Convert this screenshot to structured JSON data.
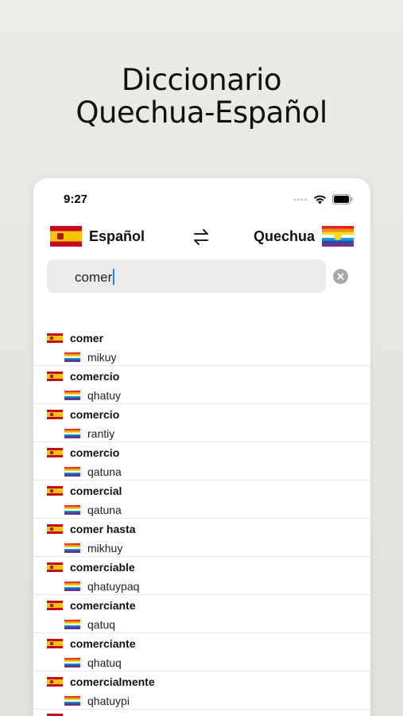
{
  "headline": {
    "line1": "Diccionario",
    "line2": "Quechua-Español"
  },
  "status_bar": {
    "time": "9:27",
    "icons": [
      "signal-dots-icon",
      "wifi-icon",
      "battery-icon"
    ]
  },
  "language_bar": {
    "source_label": "Español",
    "target_label": "Quechua",
    "source_flag": "spain-flag-icon",
    "target_flag": "quechua-flag-icon",
    "swap_icon": "swap-arrows-icon"
  },
  "search": {
    "value": "comer",
    "clear_icon": "clear-circle-icon"
  },
  "results": [
    {
      "spanish": "comer",
      "quechua": "mikuy"
    },
    {
      "spanish": "comercio",
      "quechua": "qhatuy"
    },
    {
      "spanish": "comercio",
      "quechua": "rantiy"
    },
    {
      "spanish": "comercio",
      "quechua": "qatuna"
    },
    {
      "spanish": "comercial",
      "quechua": "qatuna"
    },
    {
      "spanish": "comer hasta",
      "quechua": "mikhuy"
    },
    {
      "spanish": "comerciable",
      "quechua": "qhatuypaq"
    },
    {
      "spanish": "comerciante",
      "quechua": "qatuq"
    },
    {
      "spanish": "comerciante",
      "quechua": "qhatuq"
    },
    {
      "spanish": "comercialmente",
      "quechua": "qhatuypi"
    }
  ],
  "colors": {
    "background": "#e8e6e2",
    "accent_caret": "#2f7cf6",
    "spain_red": "#c60b1e",
    "spain_yellow": "#f6c400"
  }
}
